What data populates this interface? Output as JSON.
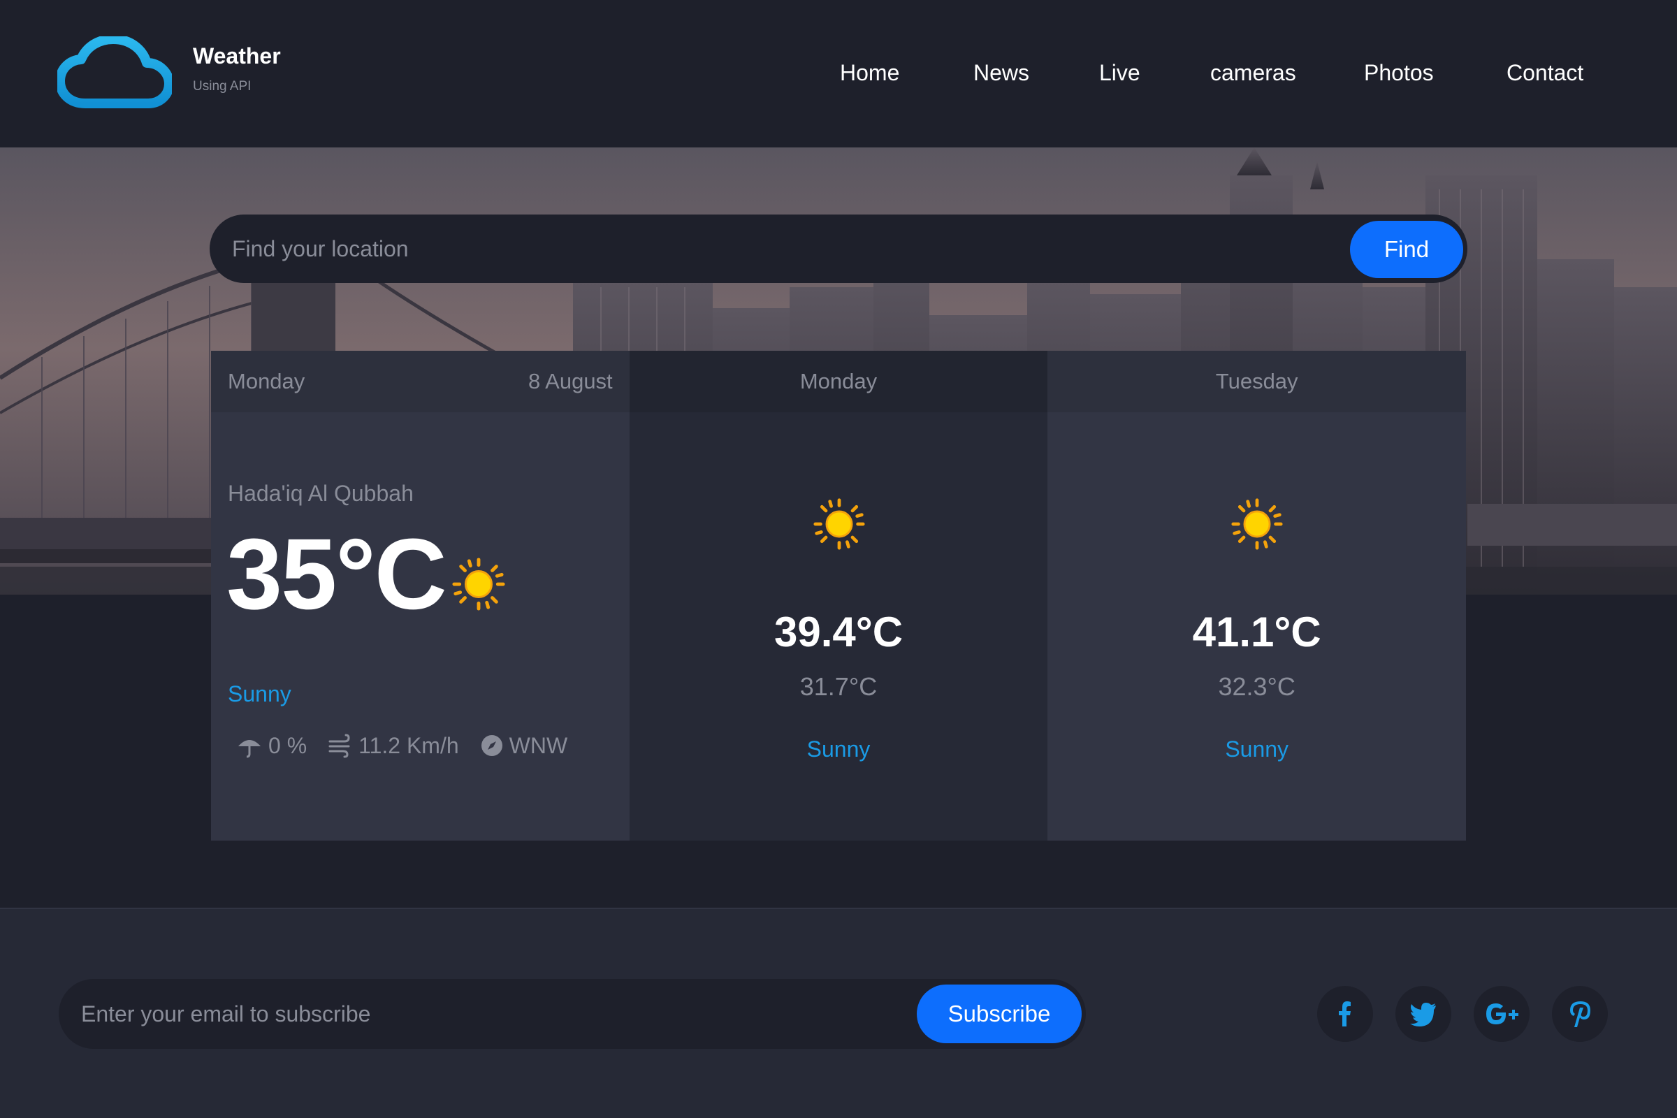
{
  "brand": {
    "title": "Weather",
    "subtitle": "Using API",
    "icon": "cloud-icon",
    "accent": "#1a9be6"
  },
  "nav": {
    "items": [
      "Home",
      "News",
      "Live",
      "cameras",
      "Photos",
      "Contact"
    ]
  },
  "search": {
    "placeholder": "Find your location",
    "button_label": "Find"
  },
  "today": {
    "day": "Monday",
    "date": "8 August",
    "location": "Hada'iq Al Qubbah",
    "temperature": "35°C",
    "icon": "sun-icon",
    "condition": "Sunny",
    "rain": "0 %",
    "wind_speed": "11.2 Km/h",
    "wind_direction": "WNW"
  },
  "forecast": [
    {
      "day": "Monday",
      "icon": "sun-icon",
      "max": "39.4°C",
      "min": "31.7°C",
      "condition": "Sunny"
    },
    {
      "day": "Tuesday",
      "icon": "sun-icon",
      "max": "41.1°C",
      "min": "32.3°C",
      "condition": "Sunny"
    }
  ],
  "subscribe": {
    "placeholder": "Enter your email to subscribe",
    "button_label": "Subscribe"
  },
  "social": [
    {
      "name": "facebook-icon",
      "glyph": "f"
    },
    {
      "name": "twitter-icon",
      "glyph": ""
    },
    {
      "name": "google-plus-icon",
      "glyph": "G+"
    },
    {
      "name": "pinterest-icon",
      "glyph": "p"
    }
  ],
  "colors": {
    "background": "#1e202b",
    "card": "#323544",
    "button": "#0d6efd",
    "muted_text": "#8a8d99"
  }
}
